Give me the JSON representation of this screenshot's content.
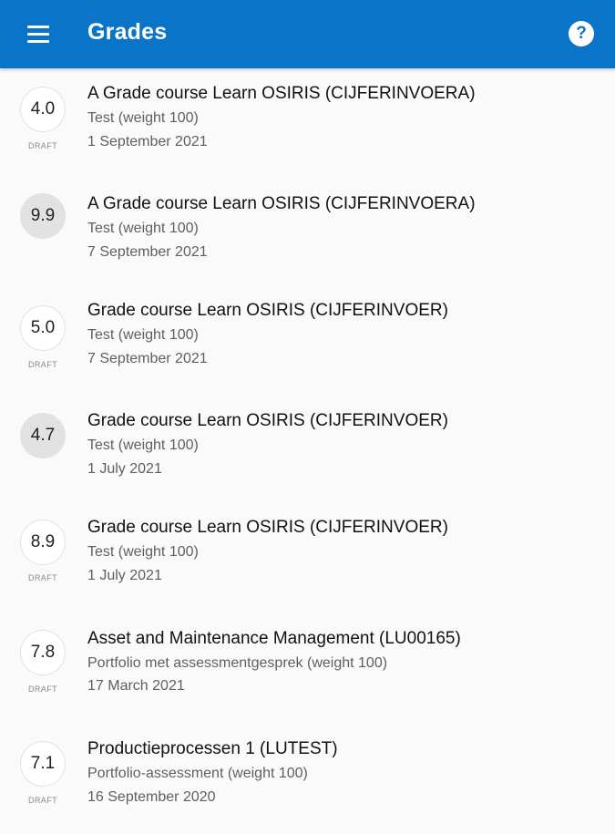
{
  "appbar": {
    "title": "Grades",
    "menu_icon": "hamburger-menu-icon",
    "help_icon": "help-circle-icon",
    "help_glyph": "?",
    "background_color": "#0a74c9"
  },
  "grades": [
    {
      "grade": "4.0",
      "status": "DRAFT",
      "course": "A Grade course Learn OSIRIS (CIJFERINVOERA)",
      "test": "Test (weight 100)",
      "date": "1 September 2021"
    },
    {
      "grade": "9.9",
      "status": "",
      "course": "A Grade course Learn OSIRIS (CIJFERINVOERA)",
      "test": "Test (weight 100)",
      "date": "7 September 2021"
    },
    {
      "grade": "5.0",
      "status": "DRAFT",
      "course": "Grade course Learn OSIRIS (CIJFERINVOER)",
      "test": "Test (weight 100)",
      "date": "7 September 2021"
    },
    {
      "grade": "4.7",
      "status": "",
      "course": "Grade course Learn OSIRIS (CIJFERINVOER)",
      "test": "Test (weight 100)",
      "date": "1 July 2021"
    },
    {
      "grade": "8.9",
      "status": "DRAFT",
      "course": "Grade course Learn OSIRIS (CIJFERINVOER)",
      "test": "Test (weight 100)",
      "date": "1 July 2021"
    },
    {
      "grade": "7.8",
      "status": "DRAFT",
      "course": "Asset and Maintenance Management (LU00165)",
      "test": "Portfolio met assessmentgesprek (weight 100)",
      "date": "17 March 2021"
    },
    {
      "grade": "7.1",
      "status": "DRAFT",
      "course": "Productieprocessen 1 (LUTEST)",
      "test": "Portfolio-assessment (weight 100)",
      "date": "16 September 2020"
    }
  ]
}
